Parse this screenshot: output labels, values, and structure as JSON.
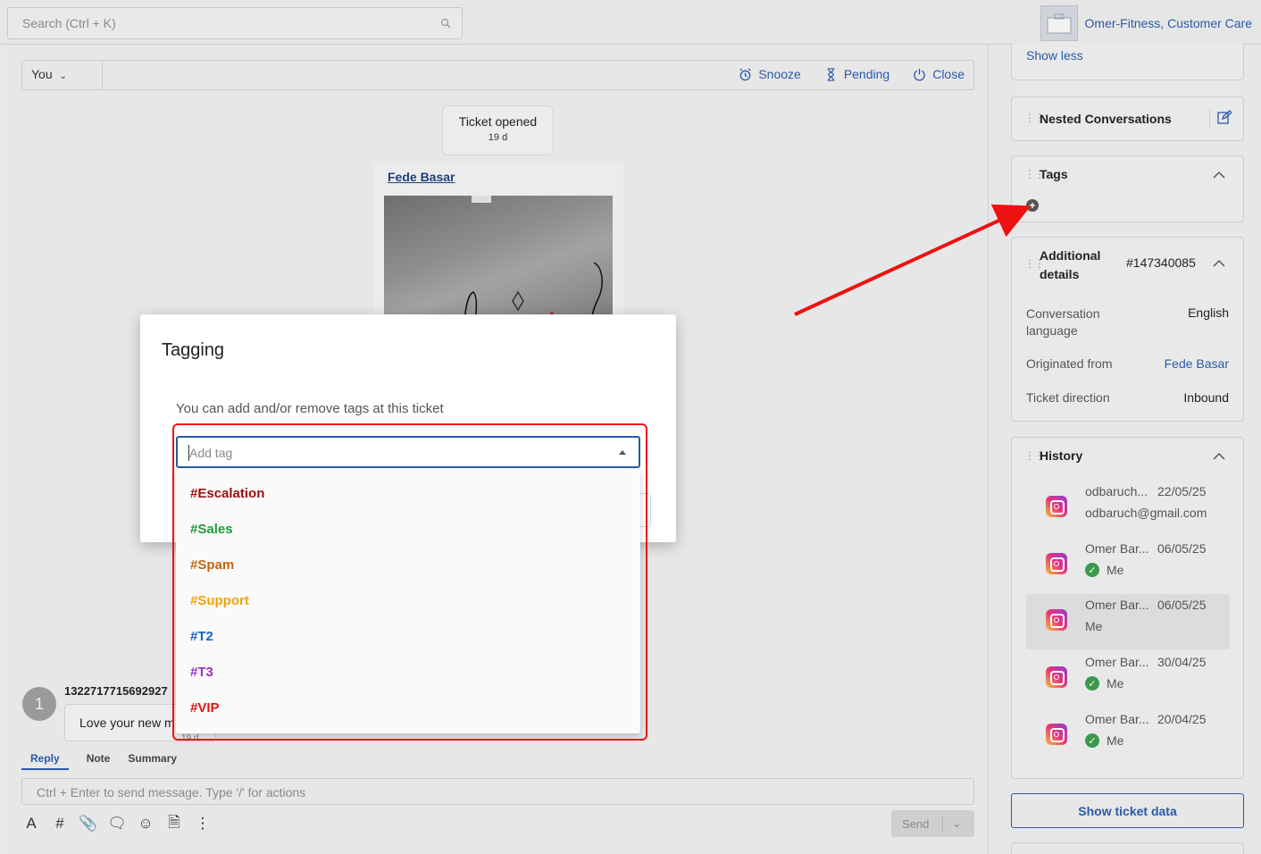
{
  "topbar": {
    "search_placeholder": "Search (Ctrl + K)",
    "account_name": "Omer-Fitness, Customer Care"
  },
  "toolbar": {
    "assignee": "You",
    "snooze": "Snooze",
    "pending": "Pending",
    "close": "Close"
  },
  "conversation": {
    "ticket_opened": "Ticket opened",
    "ticket_age": "19 d",
    "author": "Fede Basar",
    "user_avatar_initial": "1",
    "user_id": "1322717715692927",
    "message_preview": "Love your new m",
    "message_age": "19 d"
  },
  "reply": {
    "tabs": [
      "Reply",
      "Note",
      "Summary"
    ],
    "composer_placeholder": "Ctrl + Enter to send message. Type '/' for actions",
    "send_label": "Send"
  },
  "sidebar": {
    "show_less": "Show less",
    "nested_title": "Nested Conversations",
    "tags_title": "Tags",
    "additional_title_1": "Additional",
    "additional_title_2": "details",
    "ticket_number": "#147340085",
    "details": [
      {
        "label": "Conversation language",
        "value": "English"
      },
      {
        "label": "Originated from",
        "value": "Fede Basar"
      },
      {
        "label": "Ticket direction",
        "value": "Inbound"
      }
    ],
    "history_title": "History",
    "history": [
      {
        "name": "odbaruch...",
        "date": "22/05/25",
        "sub": "odbaruch@gmail.com",
        "check": false
      },
      {
        "name": "Omer Bar...",
        "date": "06/05/25",
        "sub": "Me",
        "check": true
      },
      {
        "name": "Omer Bar...",
        "date": "06/05/25",
        "sub": "Me",
        "check": false
      },
      {
        "name": "Omer Bar...",
        "date": "30/04/25",
        "sub": "Me",
        "check": true
      },
      {
        "name": "Omer Bar...",
        "date": "20/04/25",
        "sub": "Me",
        "check": true
      }
    ],
    "show_ticket_data": "Show ticket data"
  },
  "modal": {
    "title": "Tagging",
    "description": "You can add and/or remove tags at this ticket",
    "input_placeholder": "Add tag",
    "options": [
      {
        "label": "#Escalation",
        "color": "#9b1010"
      },
      {
        "label": "#Sales",
        "color": "#1e9a3c"
      },
      {
        "label": "#Spam",
        "color": "#c8650f"
      },
      {
        "label": "#Support",
        "color": "#f0a300"
      },
      {
        "label": "#T2",
        "color": "#1565c0"
      },
      {
        "label": "#T3",
        "color": "#9b30c0"
      },
      {
        "label": "#VIP",
        "color": "#e01515"
      }
    ]
  },
  "colors": {
    "accent": "#2a5aa8",
    "annotation": "#ee1111"
  }
}
